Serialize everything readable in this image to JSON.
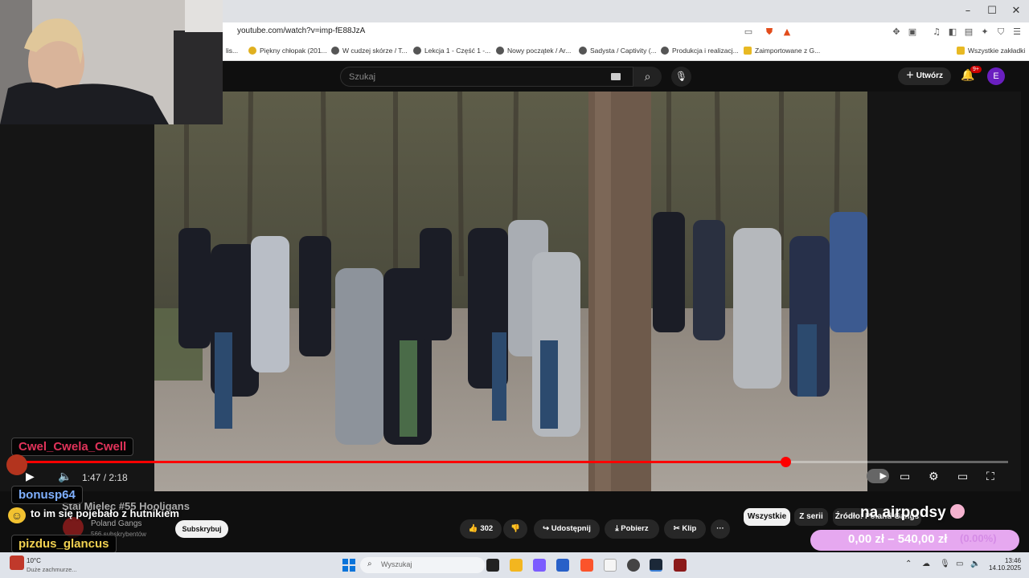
{
  "browser": {
    "url": "youtube.com/watch?v=imp-fE88JzA",
    "window_controls": [
      "–",
      "☐",
      "✕"
    ],
    "bookmarks": [
      {
        "label": "lis..."
      },
      {
        "label": "Piękny chłopak (201..."
      },
      {
        "label": "W cudzej skórze / T..."
      },
      {
        "label": "Lekcja 1 - Część 1 -..."
      },
      {
        "label": "Nowy początek / Ar..."
      },
      {
        "label": "Sadysta / Captivity (..."
      },
      {
        "label": "Produkcja i realizacj..."
      },
      {
        "label": "Zaimportowane z G..."
      }
    ],
    "all_bookmarks": "Wszystkie zakładki"
  },
  "youtube_header": {
    "search_placeholder": "Szukaj",
    "create_label": "Utwórz",
    "notifications_badge": "9+",
    "avatar_letter": "E"
  },
  "player": {
    "time_display": "1:47 / 2:18",
    "progress_fraction": 0.7754
  },
  "video_info": {
    "title": "Stal Mielec #55 Hooligans",
    "channel_name": "Poland Gangs",
    "subscribers": "566 subskrybentów",
    "subscribe_label": "Subskrybuj",
    "likes": "302",
    "share_label": "Udostępnij",
    "download_label": "Pobierz",
    "clip_label": "Klip",
    "more_label": "···"
  },
  "sidebar_chips": [
    "Wszystkie",
    "Z serii",
    "Źródło: Poland Gangs"
  ],
  "stream_overlay": {
    "chat": [
      {
        "user": "Cwel_Cwela_Cwell",
        "color": "#e0335a"
      },
      {
        "user": "bonusp64",
        "color": "#7fb0ff"
      },
      {
        "user": "pizdus_glancus",
        "color": "#f0d050"
      }
    ],
    "chat_message": "to im się pojebało z hutnikiem",
    "top_text": "na airpodsy",
    "goal_current": "0,00 zł",
    "goal_target": "540,00 zł",
    "goal_percent": "(0.00%)"
  },
  "taskbar": {
    "weather_temp": "10°C",
    "weather_desc": "Duże zachmurze...",
    "search_placeholder": "Wyszukaj",
    "time": "13:46",
    "date": "14.10.2025"
  }
}
